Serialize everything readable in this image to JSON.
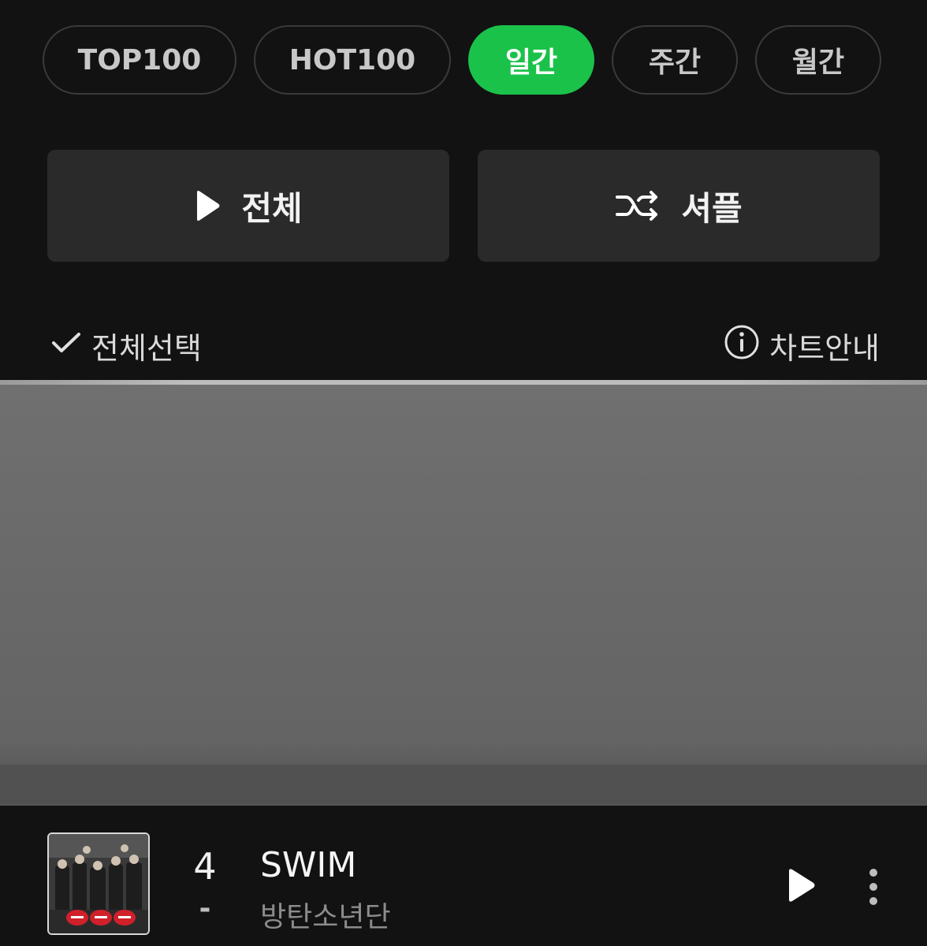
{
  "tabs": [
    {
      "label": "TOP100",
      "active": false
    },
    {
      "label": "HOT100",
      "active": false
    },
    {
      "label": "일간",
      "active": true
    },
    {
      "label": "주간",
      "active": false
    },
    {
      "label": "월간",
      "active": false
    }
  ],
  "actions": {
    "play_all_label": "전체",
    "shuffle_label": "셔플"
  },
  "list_header": {
    "select_all_label": "전체선택",
    "chart_info_label": "차트안내"
  },
  "colors": {
    "accent": "#1bc24a",
    "background": "#121212",
    "button_bg": "#2a2a2a"
  },
  "songs": [
    {
      "rank": "4",
      "rank_change": "-",
      "title": "SWIM",
      "artist": "방탄소년단"
    }
  ],
  "icons": {
    "play": "play-icon",
    "shuffle": "shuffle-icon",
    "check": "check-icon",
    "info": "info-icon",
    "more": "more-vertical-icon"
  }
}
